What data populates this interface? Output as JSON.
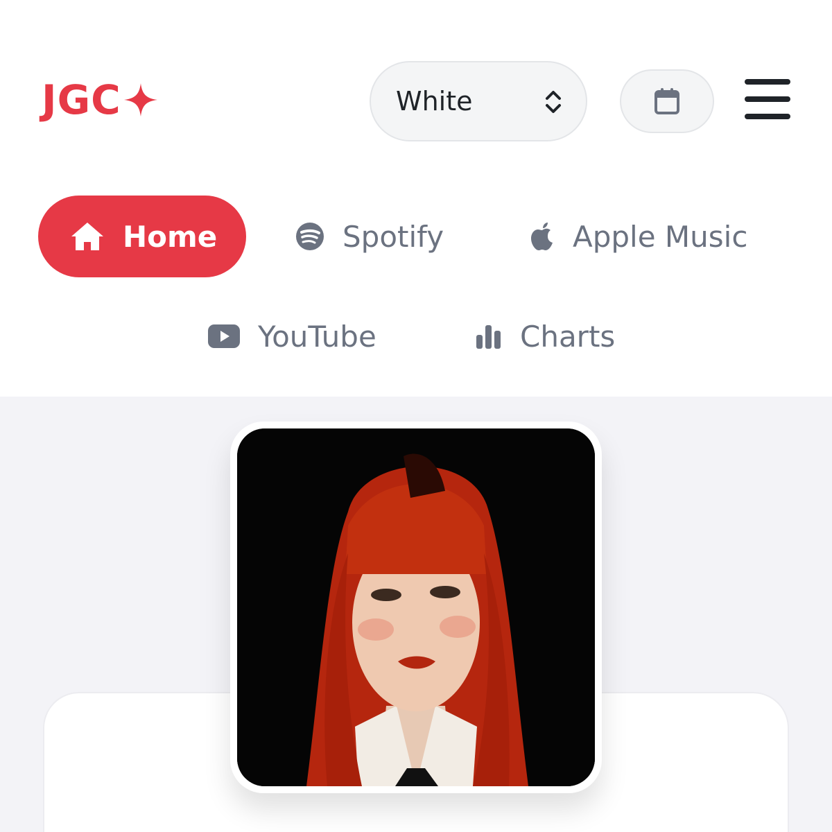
{
  "header": {
    "logo_text": "JGC",
    "logo_icon": "sparkle-icon",
    "theme_select": {
      "value": "White",
      "icon": "chevron-up-down-icon"
    },
    "calendar_icon": "calendar-icon",
    "menu_icon": "hamburger-menu-icon"
  },
  "nav": {
    "items": [
      {
        "label": "Home",
        "icon": "home-icon",
        "active": true
      },
      {
        "label": "Spotify",
        "icon": "spotify-icon",
        "active": false
      },
      {
        "label": "Apple Music",
        "icon": "apple-icon",
        "active": false
      },
      {
        "label": "YouTube",
        "icon": "youtube-icon",
        "active": false
      },
      {
        "label": "Charts",
        "icon": "bar-chart-icon",
        "active": false
      }
    ]
  },
  "main": {
    "artwork_alt": "artist portrait with red hair"
  },
  "colors": {
    "accent": "#e63946",
    "muted_text": "#6b7280",
    "page_background": "#f3f3f7"
  }
}
